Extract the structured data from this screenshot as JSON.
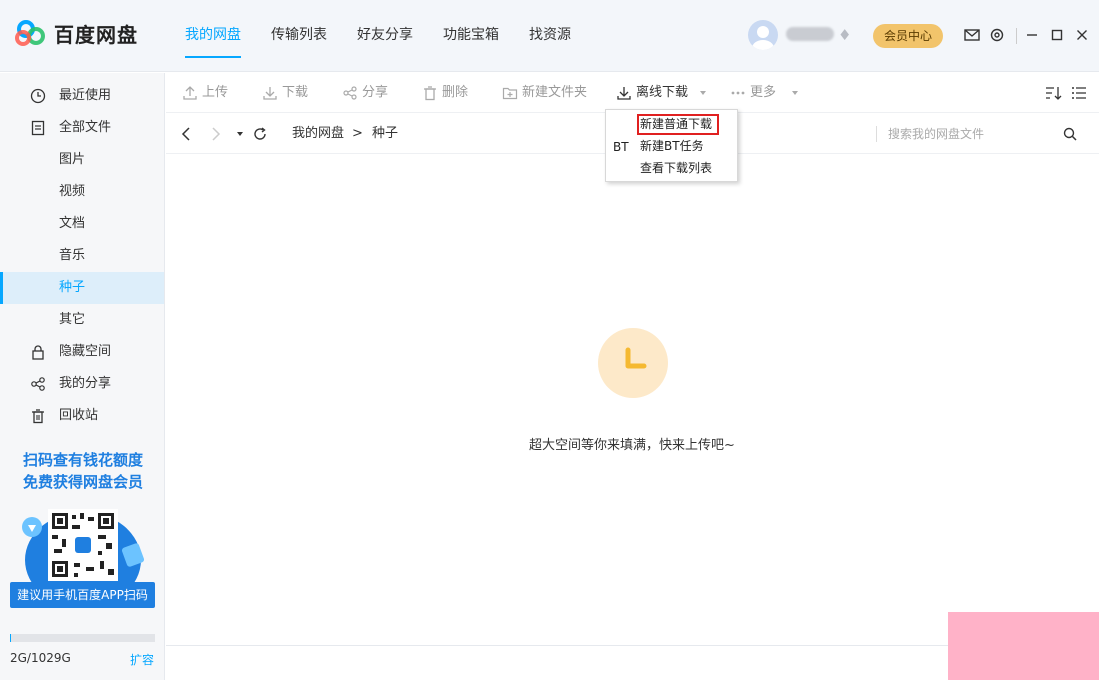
{
  "app": {
    "name": "百度网盘"
  },
  "nav": {
    "tabs": [
      "我的网盘",
      "传输列表",
      "好友分享",
      "功能宝箱",
      "找资源"
    ],
    "active": 0
  },
  "header": {
    "vip_label": "会员中心"
  },
  "sidebar": {
    "items": [
      {
        "label": "最近使用",
        "icon": "clock-icon"
      },
      {
        "label": "全部文件",
        "icon": "file-icon"
      },
      {
        "label": "图片"
      },
      {
        "label": "视频"
      },
      {
        "label": "文档"
      },
      {
        "label": "音乐"
      },
      {
        "label": "种子"
      },
      {
        "label": "其它"
      },
      {
        "label": "隐藏空间",
        "icon": "lock-icon"
      },
      {
        "label": "我的分享",
        "icon": "share-icon"
      },
      {
        "label": "回收站",
        "icon": "trash-icon"
      }
    ],
    "active_index": 6,
    "promo": {
      "line1": "扫码查有钱花额度",
      "line2": "免费获得网盘会员",
      "button": "建议用手机百度APP扫码"
    },
    "quota": {
      "text": "2G/1029G",
      "used_fraction": 0.002,
      "expand": "扩容"
    }
  },
  "toolbar": {
    "upload": "上传",
    "download": "下载",
    "share": "分享",
    "delete": "删除",
    "new_folder": "新建文件夹",
    "offline": "离线下载",
    "more": "更多"
  },
  "breadcrumb": {
    "root": "我的网盘",
    "sep": ">",
    "current": "种子"
  },
  "search": {
    "placeholder": "搜索我的网盘文件"
  },
  "dropdown": {
    "items": [
      "新建普通下载",
      "新建BT任务",
      "查看下载列表"
    ],
    "bt_badge": "BT",
    "highlighted_index": 0
  },
  "empty": {
    "message": "超大空间等你来填满，快来上传吧~"
  },
  "colors": {
    "accent": "#06a7ff",
    "vip": "#f2c46b",
    "promo_blue": "#1f7fe0",
    "highlight": "#e02020"
  }
}
